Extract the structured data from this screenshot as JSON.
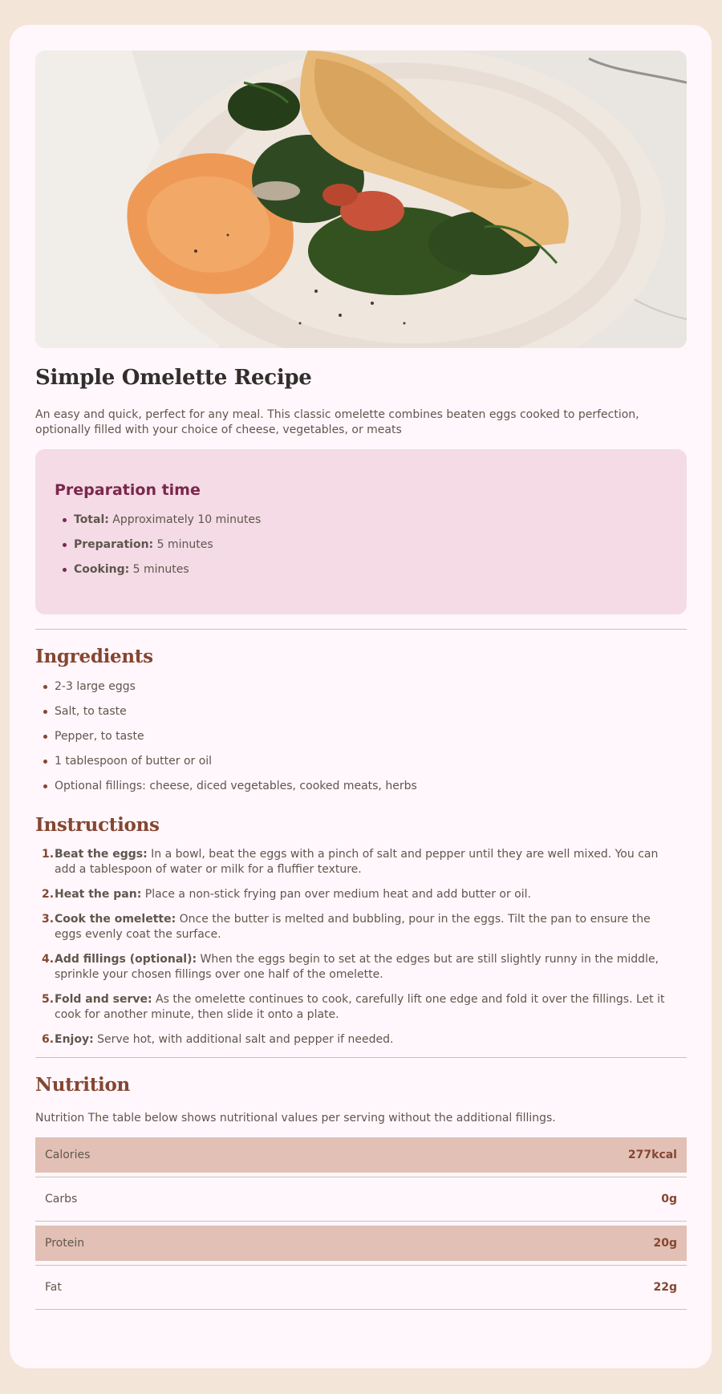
{
  "recipe": {
    "title": "Simple Omelette Recipe",
    "intro": "An easy and quick, perfect for any meal. This classic omelette combines beaten eggs cooked to perfection, optionally filled with your choice of cheese, vegetables, or meats"
  },
  "preparation": {
    "heading": "Preparation time",
    "items": [
      {
        "label": "Total:",
        "value": " Approximately 10 minutes"
      },
      {
        "label": "Preparation:",
        "value": " 5 minutes"
      },
      {
        "label": "Cooking:",
        "value": " 5 minutes"
      }
    ]
  },
  "ingredients": {
    "heading": "Ingredients",
    "items": [
      "2-3 large eggs",
      "Salt, to taste",
      "Pepper, to taste",
      "1 tablespoon of butter or oil",
      "Optional fillings: cheese, diced vegetables, cooked meats, herbs"
    ]
  },
  "instructions": {
    "heading": "Instructions",
    "steps": [
      {
        "num": "1.",
        "label": "Beat the eggs:",
        "text": " In a bowl, beat the eggs with a pinch of salt and pepper until they are well mixed. You can add a tablespoon of water or milk for a fluffier texture."
      },
      {
        "num": "2.",
        "label": "Heat the pan:",
        "text": " Place a non-stick frying pan over medium heat and add butter or oil."
      },
      {
        "num": "3.",
        "label": "Cook the omelette:",
        "text": " Once the butter is melted and bubbling, pour in the eggs. Tilt the pan to ensure the eggs evenly coat the surface."
      },
      {
        "num": "4.",
        "label": "Add fillings (optional):",
        "text": " When the eggs begin to set at the edges but are still slightly runny in the middle, sprinkle your chosen fillings over one half of the omelette."
      },
      {
        "num": "5.",
        "label": "Fold and serve:",
        "text": " As the omelette continues to cook, carefully lift one edge and fold it over the fillings. Let it cook for another minute, then slide it onto a plate."
      },
      {
        "num": "6.",
        "label": "Enjoy:",
        "text": " Serve hot, with additional salt and pepper if needed."
      }
    ]
  },
  "nutrition": {
    "heading": "Nutrition",
    "description": "Nutrition The table below shows nutritional values per serving without the additional fillings.",
    "rows": [
      {
        "name": "Calories",
        "value": "277kcal"
      },
      {
        "name": "Carbs",
        "value": "0g"
      },
      {
        "name": "Protein",
        "value": "20g"
      },
      {
        "name": "Fat",
        "value": "22g"
      }
    ]
  },
  "colors": {
    "page_bg": "#f3e5d8",
    "card_bg": "#fff7fb",
    "prep_bg": "#f4dbe6",
    "prep_accent": "#7a284b",
    "section_accent": "#854632",
    "table_shade": "#e2c0b5"
  }
}
